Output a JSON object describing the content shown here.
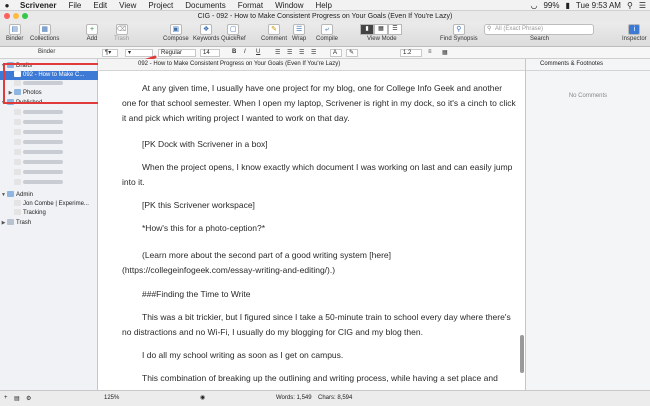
{
  "menubar": {
    "apple": "",
    "app_name": "Scrivener",
    "items": [
      "File",
      "Edit",
      "View",
      "Project",
      "Documents",
      "Format",
      "Window",
      "Help"
    ],
    "battery": "99%",
    "clock": "Tue 9:53 AM"
  },
  "window": {
    "title": "CIG - 092 - How to Make Consistent Progress on Your Goals (Even If You're Lazy)"
  },
  "toolbar": {
    "binder": "Binder",
    "collections": "Collections",
    "add": "Add",
    "trash": "Trash",
    "compose": "Compose",
    "keywords": "Keywords",
    "quickref": "QuickRef",
    "comment": "Comment",
    "wrap": "Wrap",
    "compile": "Compile",
    "view_mode": "View Mode",
    "find_synopsis": "Find Synopsis",
    "search_placeholder": "All (Exact Phrase)",
    "search_label": "Search",
    "inspector": "Inspector"
  },
  "formatbar": {
    "binder_label": "Binder",
    "style": "Regular",
    "size": "14",
    "bold": "B",
    "italic": "I",
    "underline": "U",
    "line_spacing": "1.2"
  },
  "binder": {
    "drafts": "Drafts",
    "selected_doc": "092 - How to Make C...",
    "photos": "Photos",
    "published": "Published",
    "admin": "Admin",
    "admin_child_1": "Jon Combe | Experime...",
    "admin_child_2": "Tracking",
    "trash": "Trash"
  },
  "editor": {
    "header_title": "092 - How to Make Consistent Progress on Your Goals (Even If You're Lazy)",
    "paragraphs": [
      "At any given time, I usually have one project for my blog, one for College Info Geek and another one for that school semester. When I open my laptop, Scrivener is right in my dock, so it's a cinch to click it and pick which writing project I wanted to work on that day.",
      "[PK Dock with Scrivener in a box]",
      "When the project opens, I know exactly which document I was working on last and can easily jump into it.",
      "[PK this Scrivener workspace]",
      "*How's this for a photo-ception?*",
      "(Learn more about the second part of a good writing system [here](https://collegeinfogeek.com/essay-writing-and-editing/).)",
      "###Finding the Time to Write",
      "This was a bit trickier, but I figured since I take a 50-minute train to school every day where there's no distractions and no Wi-Fi, I usually do my blogging for CIG and my blog then.",
      "I do all my school writing as soon as I get on campus.",
      "This combination of breaking up the outlining and writing process, while having a set place and"
    ]
  },
  "inspector": {
    "heading": "Comments & Footnotes",
    "empty": "No Comments"
  },
  "statusbar": {
    "zoom": "125%",
    "words": "Words: 1,549",
    "chars": "Chars: 8,594"
  }
}
